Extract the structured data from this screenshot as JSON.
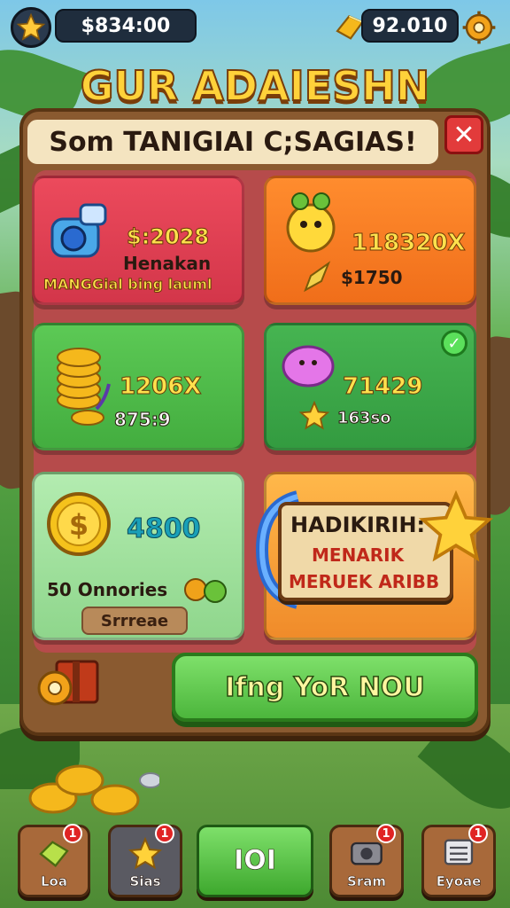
{
  "topbar": {
    "coins": "$834:00",
    "gems": "92.010"
  },
  "title": "GUR ADAIESHN",
  "header": "Som TANIGIAI C;SAGIAS!",
  "cards": [
    {
      "value": "$:2028",
      "label": "Henakan",
      "sub": "MANGGial bing lauml"
    },
    {
      "value": "118320X",
      "sub": "$1750"
    },
    {
      "value": "1206X",
      "sub": "875:9"
    },
    {
      "value": "71429",
      "sub": "163so"
    },
    {
      "value": "4800",
      "sub": "50 Onnories",
      "button": "Srrreae"
    },
    {
      "banner_title": "HADIKIRIH:",
      "banner_line1": "MENARIK",
      "banner_line2": "MERUEK ARIBB"
    }
  ],
  "play_label": "Ifng YoR NOU",
  "nav": [
    {
      "label": "Loa",
      "badge": "1"
    },
    {
      "label": "Sias",
      "badge": "1"
    },
    {
      "label": "IOI"
    },
    {
      "label": "Sram",
      "badge": "1"
    },
    {
      "label": "Eyoae",
      "badge": "1"
    }
  ],
  "colors": {
    "accent": "#ffd23a",
    "panel": "#8a5a30",
    "close": "#e23b3b",
    "play": "#4cb63c"
  }
}
